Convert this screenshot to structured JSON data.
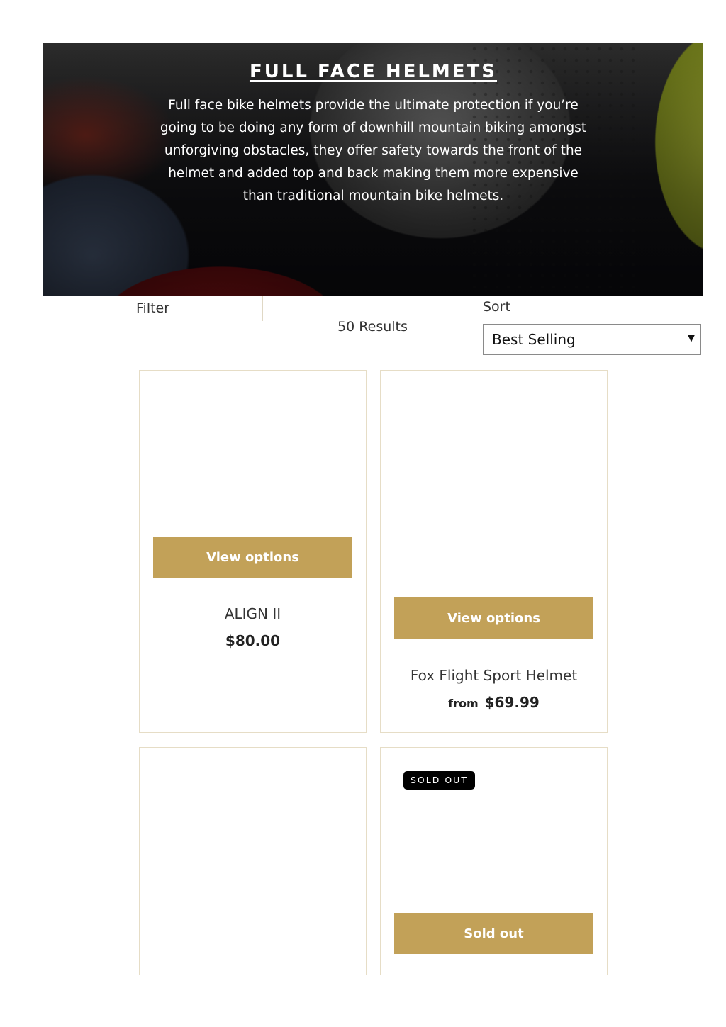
{
  "hero": {
    "title": "FULL FACE HELMETS",
    "description": "Full face bike helmets provide the ultimate protection if you’re going to be doing any form of downhill mountain biking amongst unforgiving obstacles, they offer safety towards the front of the helmet and added top and back making them more expensive than traditional mountain bike helmets."
  },
  "toolbar": {
    "filter_label": "Filter",
    "results_count": "50 Results",
    "sort_label": "Sort",
    "sort_value": "Best Selling",
    "sort_caret": "▼"
  },
  "products": [
    {
      "button_label": "View options",
      "title": "ALIGN II",
      "price": "$80.00"
    },
    {
      "button_label": "View options",
      "title": "Fox Flight Sport Helmet",
      "price_prefix": "from",
      "price": "$69.99"
    },
    {
      "button_label": ""
    },
    {
      "badge": "SOLD OUT",
      "button_label": "Sold out"
    }
  ],
  "colors": {
    "accent": "#c2a158",
    "card_border": "#e6ddc6",
    "badge_bg": "#000000"
  }
}
